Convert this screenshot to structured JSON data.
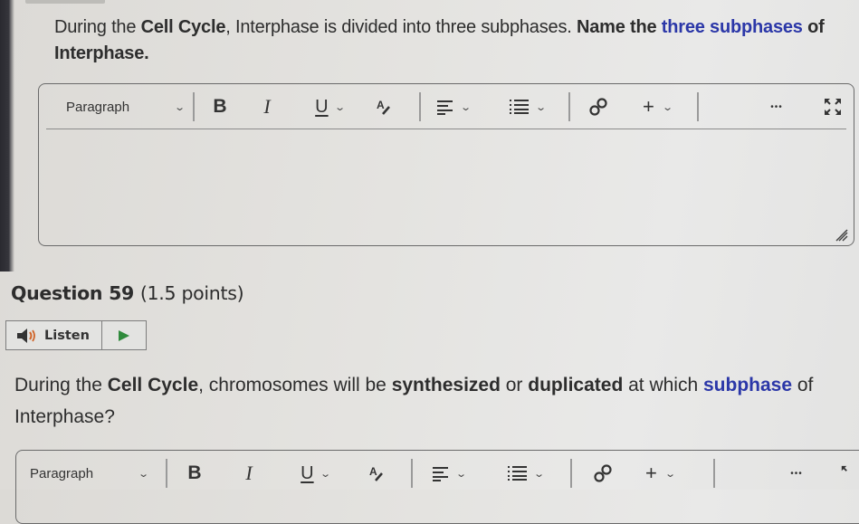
{
  "question_prev": {
    "text_parts": [
      {
        "text": "During the ",
        "style": "normal"
      },
      {
        "text": "Cell Cycle",
        "style": "bold"
      },
      {
        "text": ", Interphase is divided into three subphases.  ",
        "style": "normal"
      },
      {
        "text": "Name the ",
        "style": "bold"
      },
      {
        "text": "three subphases",
        "style": "blue"
      },
      {
        "text": " of Interphase.",
        "style": "bold"
      }
    ]
  },
  "editor": {
    "block_format": "Paragraph",
    "buttons": {
      "bold": "B",
      "italic": "I",
      "underline": "U",
      "more": "•••",
      "insert": "+"
    },
    "answer_value": ""
  },
  "question": {
    "title": "Question 59",
    "points": "(1.5 points)",
    "listen_label": "Listen",
    "text_parts": [
      {
        "text": "During the ",
        "style": "normal"
      },
      {
        "text": "Cell Cycle",
        "style": "bold"
      },
      {
        "text": ", chromosomes will be ",
        "style": "normal"
      },
      {
        "text": "synthesized",
        "style": "bold"
      },
      {
        "text": " or ",
        "style": "normal"
      },
      {
        "text": "duplicated",
        "style": "bold"
      },
      {
        "text": " at which ",
        "style": "normal"
      },
      {
        "text": "subphase",
        "style": "blue"
      },
      {
        "text": " of Interphase?",
        "style": "normal"
      }
    ]
  },
  "colors": {
    "accent_blue": "#2b37a8",
    "play_green": "#2f8a3c",
    "speaker_orange": "#d0652a"
  }
}
